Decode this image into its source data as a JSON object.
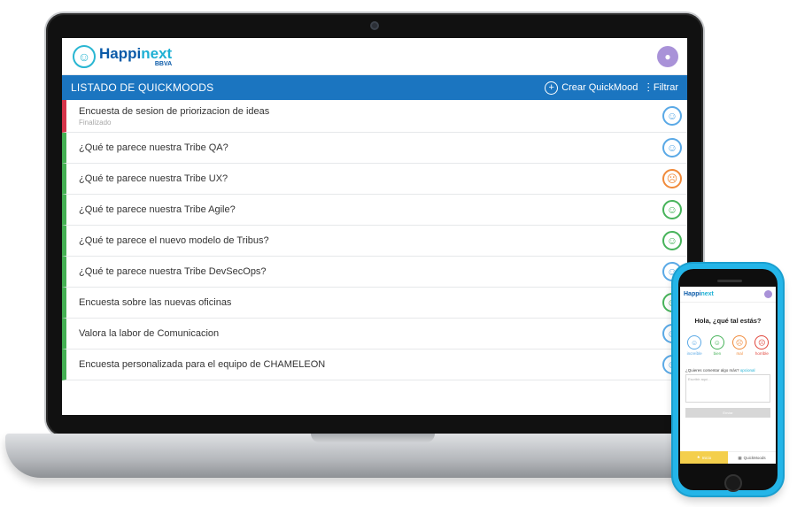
{
  "laptop": {
    "brand": {
      "name_main": "Happi",
      "name_accent": "next",
      "sub": "BBVA"
    },
    "toolbar": {
      "title": "LISTADO DE QUICKMOODS",
      "create_label": "Crear QuickMood",
      "filter_label": "Filtrar"
    },
    "rows": [
      {
        "title": "Encuesta de sesion de priorizacion de ideas",
        "subtitle": "Finalizado",
        "status_color": "#d6344a",
        "mood": "blue"
      },
      {
        "title": "¿Qué te parece nuestra Tribe QA?",
        "mood": "blue"
      },
      {
        "title": "¿Qué te parece nuestra Tribe UX?",
        "mood": "orange"
      },
      {
        "title": "¿Qué te parece nuestra Tribe Agile?",
        "mood": "green"
      },
      {
        "title": "¿Qué te parece el nuevo modelo de Tribus?",
        "mood": "green"
      },
      {
        "title": "¿Qué te parece nuestra Tribe DevSecOps?",
        "mood": "blue"
      },
      {
        "title": "Encuesta sobre las nuevas oficinas",
        "mood": "green"
      },
      {
        "title": "Valora la labor de Comunicacion",
        "mood": "blue"
      },
      {
        "title": "Encuesta personalizada para el equipo de CHAMELEON",
        "mood": "blue"
      }
    ],
    "colors": {
      "toolbar_bg": "#1b75c0",
      "open_status": "#44b053",
      "closed_status": "#d6344a"
    }
  },
  "phone": {
    "brand": {
      "name_main": "Happi",
      "name_accent": "next"
    },
    "greeting": "Hola, ¿qué tal estás?",
    "moods": [
      {
        "label": "increíble",
        "color": "#5aa9e6"
      },
      {
        "label": "bien",
        "color": "#47b35a"
      },
      {
        "label": "mal",
        "color": "#f08a3a"
      },
      {
        "label": "horrible",
        "color": "#e0453b"
      }
    ],
    "comment_question": "¿Quieres comentar algo más?",
    "comment_link": "opcional",
    "comment_placeholder": "Escribir aquí...",
    "send_label": "Enviar",
    "tabs": {
      "mood_label": "Inicio",
      "quickmoods_label": "QuickMoods"
    }
  }
}
